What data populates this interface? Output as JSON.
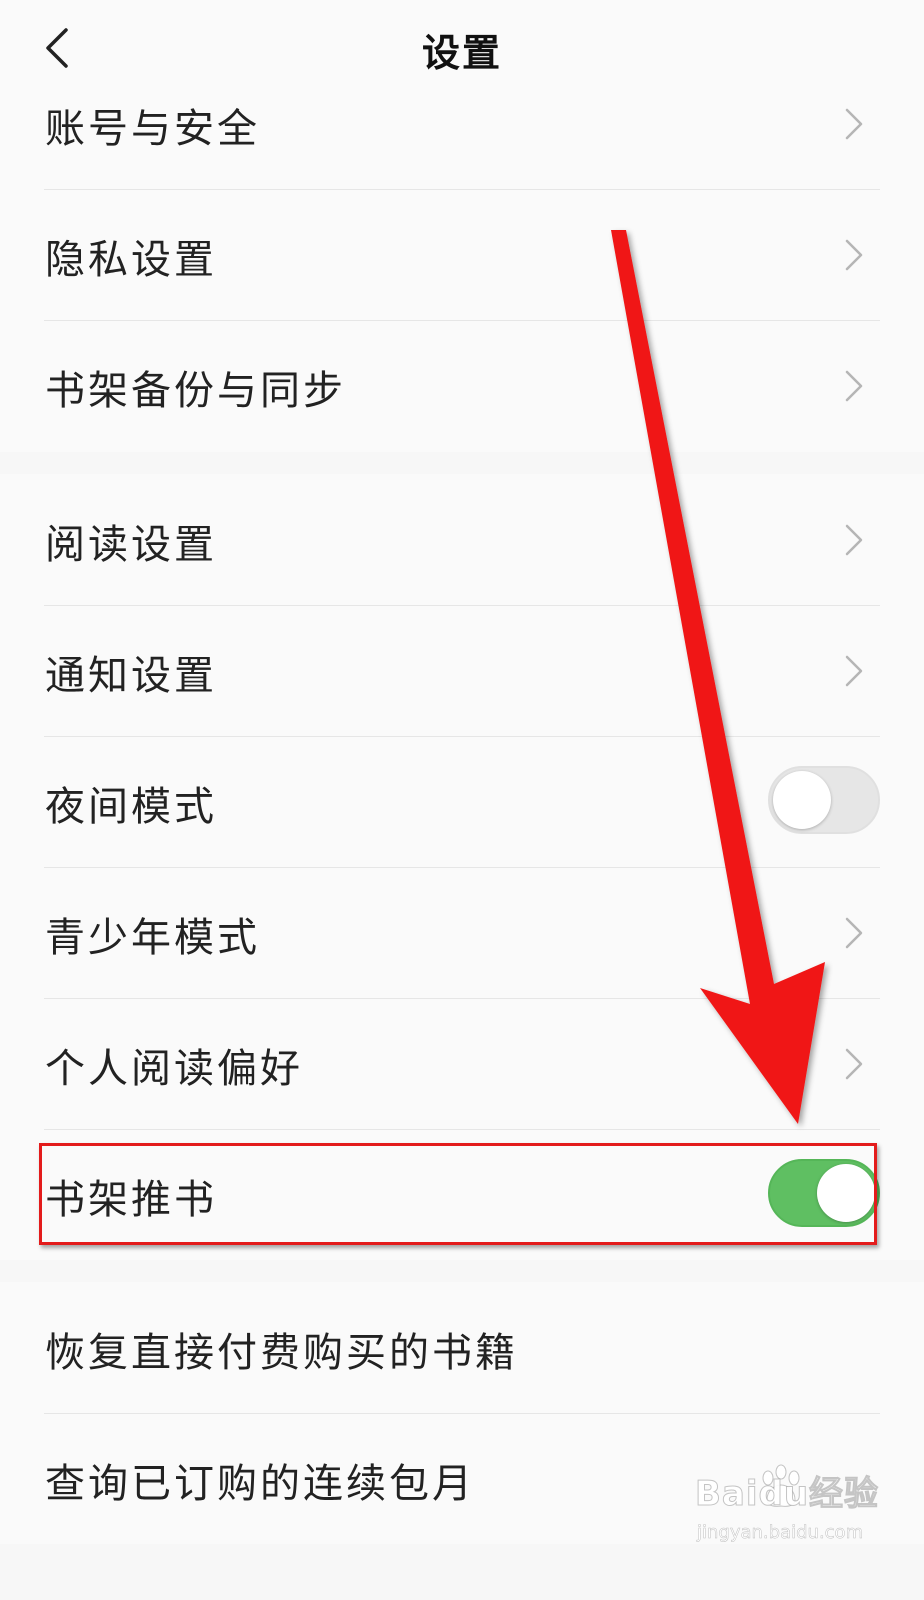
{
  "header": {
    "title": "设置",
    "back_icon": "chevron-left-icon"
  },
  "sections": [
    {
      "items": [
        {
          "label": "账号与安全",
          "control": "chevron"
        },
        {
          "label": "隐私设置",
          "control": "chevron"
        },
        {
          "label": "书架备份与同步",
          "control": "chevron"
        }
      ]
    },
    {
      "items": [
        {
          "label": "阅读设置",
          "control": "chevron"
        },
        {
          "label": "通知设置",
          "control": "chevron"
        },
        {
          "label": "夜间模式",
          "control": "toggle",
          "on": false
        },
        {
          "label": "青少年模式",
          "control": "chevron"
        },
        {
          "label": "个人阅读偏好",
          "control": "chevron"
        },
        {
          "label": "书架推书",
          "control": "toggle",
          "on": true
        }
      ]
    },
    {
      "items": [
        {
          "label": "恢复直接付费购买的书籍",
          "control": "none"
        },
        {
          "label": "查询已订购的连续包月",
          "control": "none"
        }
      ]
    }
  ],
  "annotation": {
    "highlight_color": "#e31b1b",
    "arrow_color": "#f01515",
    "target": "书架推书"
  },
  "watermark": {
    "text": "Baidu经验",
    "sub": "jingyan.baidu.com"
  },
  "colors": {
    "toggle_on": "#5fbf62",
    "toggle_off": "#e6e6e6",
    "background": "#f7f7f7",
    "row_background": "#fafafa"
  }
}
